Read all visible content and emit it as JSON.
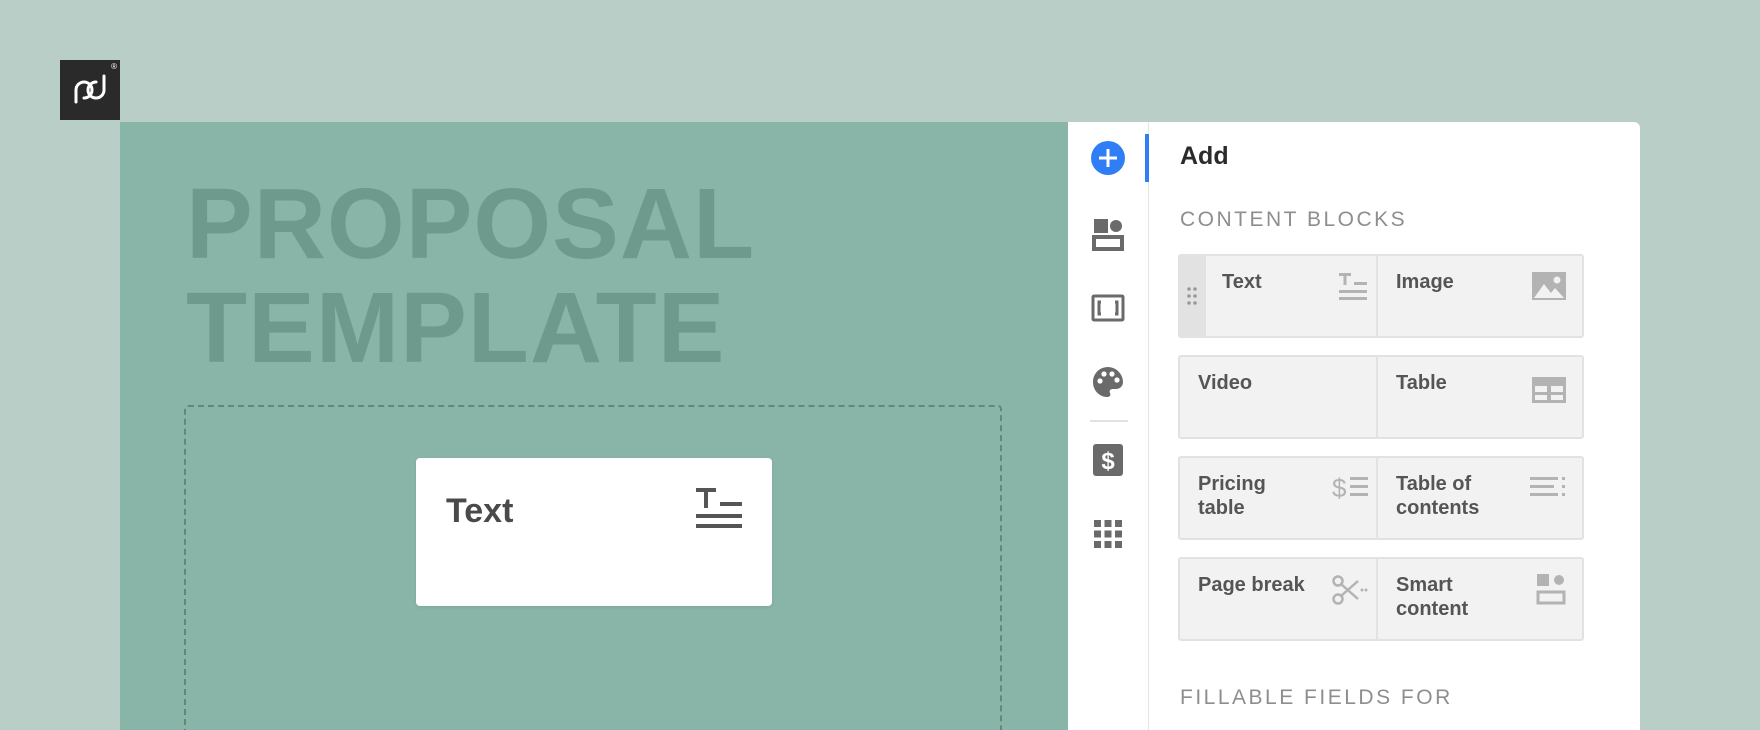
{
  "canvas": {
    "title_line1": "PROPOSAL",
    "title_line2": "TEMPLATE",
    "drag_card_label": "Text"
  },
  "sidebar": {
    "rail_items": [
      "add-icon",
      "content-blocks-icon",
      "frame-icon",
      "palette-icon",
      "dollar-icon",
      "apps-grid-icon"
    ],
    "panel_title": "Add",
    "section_content_blocks": "CONTENT BLOCKS",
    "section_fillable": "FILLABLE FIELDS FOR",
    "blocks": [
      {
        "label": "Text",
        "icon": "text-block-icon"
      },
      {
        "label": "Image",
        "icon": "image-icon"
      },
      {
        "label": "Video",
        "icon": ""
      },
      {
        "label": "Table",
        "icon": "table-icon"
      },
      {
        "label": "Pricing table",
        "icon": "pricing-table-icon"
      },
      {
        "label": "Table of contents",
        "icon": "toc-icon"
      },
      {
        "label": "Page break",
        "icon": "scissors-icon"
      },
      {
        "label": "Smart content",
        "icon": "smart-content-icon"
      }
    ]
  },
  "colors": {
    "background": "#b8cec6",
    "canvas": "#88b5a7",
    "accent": "#2f7ef6",
    "icon_gray": "#6a6a6a",
    "block_icon_gray": "#b3b3b3"
  }
}
